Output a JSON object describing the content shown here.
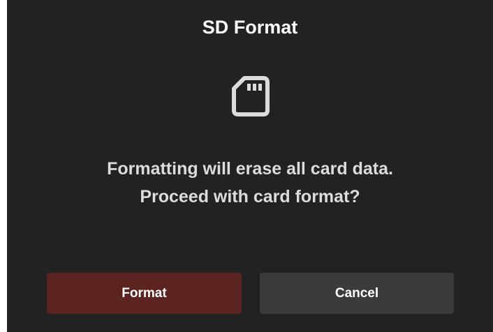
{
  "dialog": {
    "title": "SD Format",
    "icon": "sd-card-icon",
    "message_line1": "Formatting will erase all card data.",
    "message_line2": "Proceed with card format?"
  },
  "buttons": {
    "format_label": "Format",
    "cancel_label": "Cancel"
  },
  "colors": {
    "background": "#222222",
    "format_button": "#5b2420",
    "cancel_button": "#3b3b3b",
    "text": "#ffffff"
  }
}
